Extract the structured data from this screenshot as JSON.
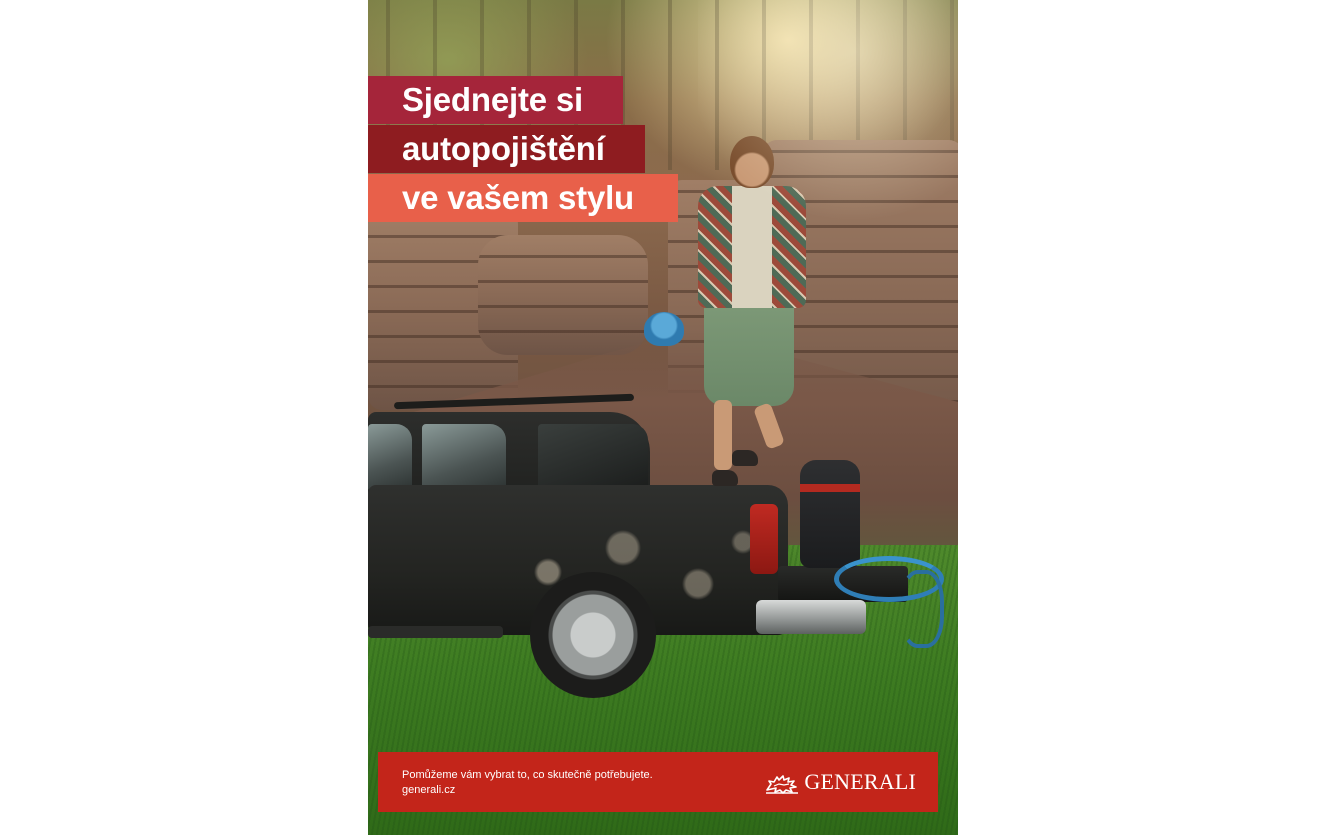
{
  "advert": {
    "headline": {
      "line1": "Sjednejte si",
      "line2": "autopojištění",
      "line3": "ve vašem stylu"
    },
    "footer": {
      "tagline": "Pomůžeme vám vybrat to, co skutečně potřebujete.",
      "website": "generali.cz",
      "brand": "GENERALI"
    },
    "colors": {
      "headline_band_1": "#a5253a",
      "headline_band_2": "#8e1c20",
      "headline_band_3": "#e8604a",
      "footer_bar": "#c3251a"
    },
    "icons": {
      "brand_logo": "generali-lion-icon"
    }
  }
}
